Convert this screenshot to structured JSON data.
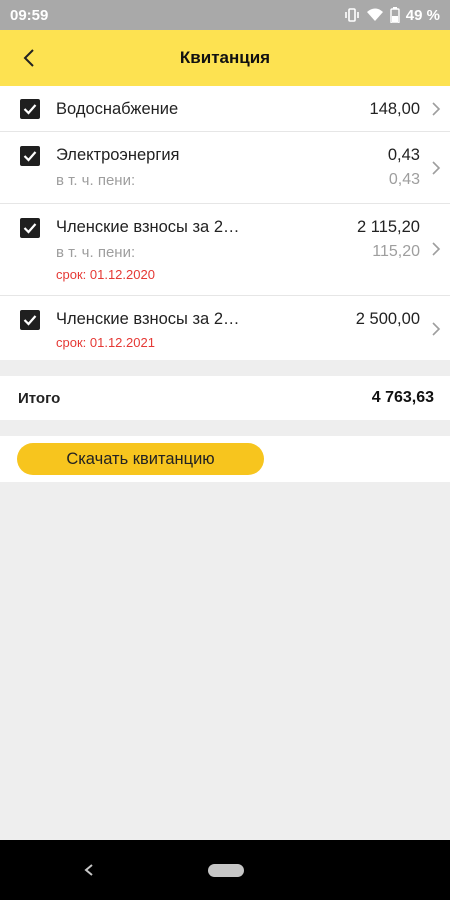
{
  "status_bar": {
    "time": "09:59",
    "battery": "49 %"
  },
  "app_bar": {
    "title": "Квитанция"
  },
  "items": [
    {
      "title": "Водоснабжение",
      "amount": "148,00",
      "checked": true
    },
    {
      "title": "Электроэнергия",
      "amount": "0,43",
      "sub_label": "в т. ч. пени:",
      "sub_amount": "0,43",
      "checked": true
    },
    {
      "title": "Членские взносы за 2…",
      "amount": "2 115,20",
      "sub_label": "в т. ч. пени:",
      "sub_amount": "115,20",
      "deadline": "срок: 01.12.2020",
      "checked": true
    },
    {
      "title": "Членские взносы за 2…",
      "amount": "2 500,00",
      "deadline": "срок: 01.12.2021",
      "checked": true
    }
  ],
  "total": {
    "label": "Итого",
    "value": "4 763,63"
  },
  "actions": {
    "download_label": "Скачать квитанцию"
  },
  "colors": {
    "accent_yellow": "#fde251",
    "button_yellow": "#f7c51e",
    "deadline_red": "#e53935"
  }
}
